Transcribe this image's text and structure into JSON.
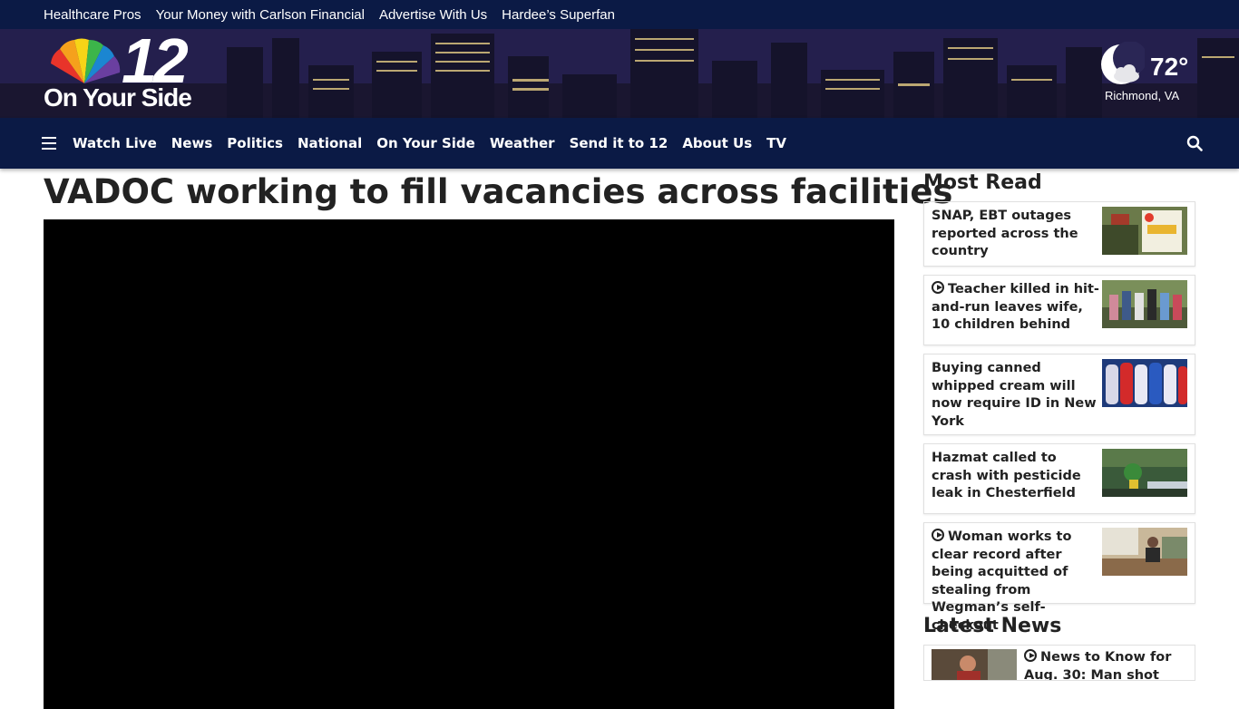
{
  "topbar": {
    "links": [
      "Healthcare Pros",
      "Your Money with Carlson Financial",
      "Advertise With Us",
      "Hardee’s Superfan"
    ]
  },
  "brand": {
    "logo_number": "12",
    "logo_tagline": "On Your Side",
    "accent": "#0b1a45"
  },
  "weather": {
    "temp": "72°",
    "city": "Richmond, VA",
    "icon": "moon-cloud-icon"
  },
  "nav": {
    "items": [
      "Watch Live",
      "News",
      "Politics",
      "National",
      "On Your Side",
      "Weather",
      "Send it to 12",
      "About Us",
      "TV"
    ]
  },
  "article": {
    "headline": "VADOC working to fill vacancies across facilities"
  },
  "most_read": {
    "title": "Most Read",
    "items": [
      {
        "text": "SNAP, EBT outages reported across the country",
        "video": false
      },
      {
        "text": "Teacher killed in hit-and-run leaves wife, 10 children behind",
        "video": true
      },
      {
        "text": "Buying canned whipped cream will now require ID in New York",
        "video": false
      },
      {
        "text": "Hazmat called to crash with pesticide leak in Chesterfield",
        "video": false
      },
      {
        "text": "Woman works to clear record after being acquitted of stealing from Wegman’s self-checkout",
        "video": true
      }
    ]
  },
  "latest_news": {
    "title": "Latest News",
    "items": [
      {
        "text": "News to Know for Aug. 30: Man shot",
        "video": true
      }
    ]
  }
}
